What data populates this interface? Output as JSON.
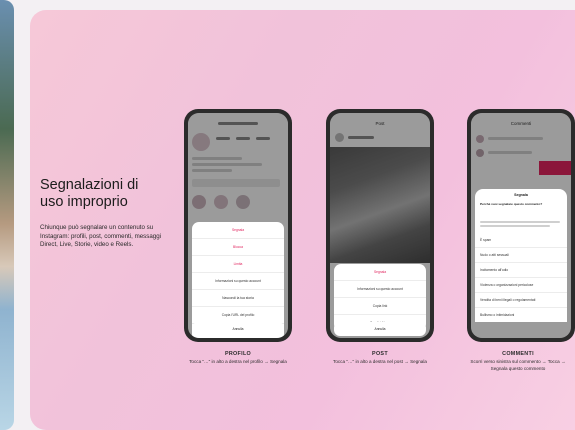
{
  "heading": {
    "line1": "Segnalazioni di",
    "line2": "uso improprio"
  },
  "description": "Chiunque può segnalare un contenuto su Instagram: profili, post, commenti, messaggi Direct, Live, Storie, video e Reels.",
  "panels": [
    {
      "caption_title": "PROFILO",
      "caption_text": "Tocca \"…\" in alto a destra nel profilo → Segnala",
      "sheet": {
        "header": "Segnala",
        "items": [
          "Blocca",
          "Limita",
          "Informazioni su questo account",
          "Nascondi la tua storia",
          "Copia l'URL del profilo",
          "Condividi questo profilo"
        ],
        "cancel": "Annulla"
      }
    },
    {
      "caption_title": "POST",
      "caption_text": "Tocca \"…\" in alto a destra nel post → Segnala",
      "screen_title": "Post",
      "sheet": {
        "header": "Segnala",
        "items": [
          "Informazioni su questo account",
          "Copia link",
          "Condividi in…"
        ],
        "cancel": "Annulla"
      }
    },
    {
      "caption_title": "COMMENTI",
      "caption_text": "Scorri verso sinistra sul commento → Tocca → Segnala questo commento",
      "screen_title": "Commenti",
      "sheet": {
        "header": "Segnala",
        "question": "Perché vuoi segnalare questo commento?",
        "items": [
          "È spam",
          "Nudo o atti sessuali",
          "Incitamento all'odio",
          "Violenza o organizzazioni pericolose",
          "Vendita di beni illegali o regolamentati",
          "Bullismo o intimidazioni"
        ]
      }
    }
  ],
  "colors": {
    "card_gradient_start": "#f6c8d8",
    "card_gradient_end": "#f8cfe3",
    "danger": "#e0245e",
    "phone_frame": "#2b2b2b"
  }
}
